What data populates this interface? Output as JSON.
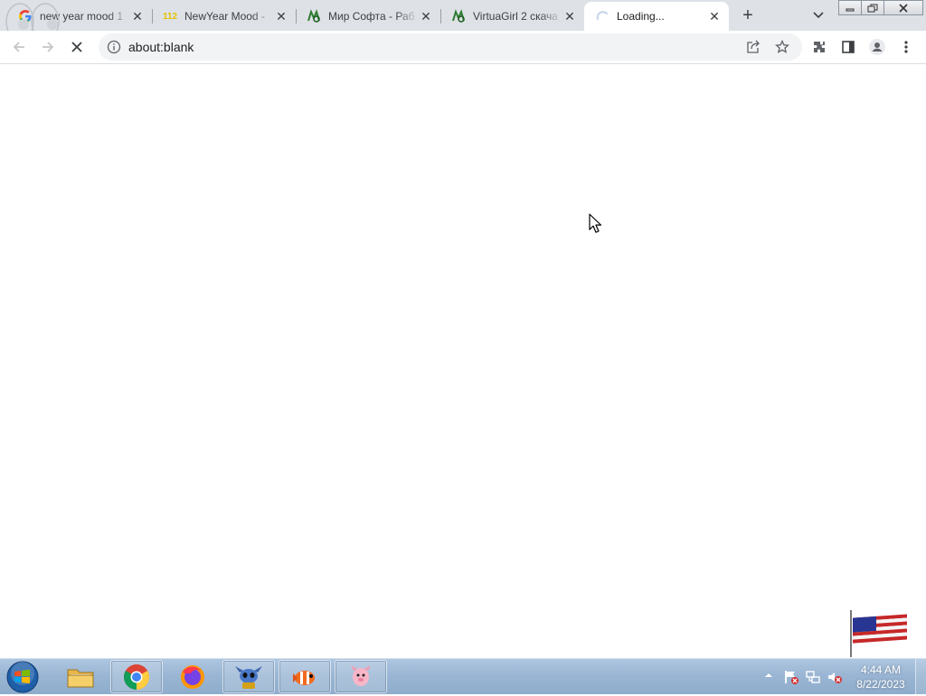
{
  "browser": {
    "tabs": [
      {
        "title": "new year mood 1",
        "favicon": "google-icon",
        "active": false
      },
      {
        "title": "NewYear Mood - ",
        "favicon": "site-112-icon",
        "favicon_text": "112",
        "active": false
      },
      {
        "title": "Мир Софта - Раб",
        "favicon": "mirsofta-icon",
        "active": false
      },
      {
        "title": "VirtuaGirl 2 скача",
        "favicon": "mirsofta-icon",
        "active": false
      },
      {
        "title": "Loading...",
        "favicon": "loading-spinner-icon",
        "active": true
      }
    ],
    "new_tab_icon": "plus-icon",
    "tab_search_icon": "chevron-down-icon",
    "address": {
      "url": "about:blank",
      "security_icon": "info-icon"
    },
    "toolbar_icons": [
      "back-icon",
      "forward-icon",
      "stop-icon",
      "share-icon",
      "star-icon",
      "extensions-icon",
      "side-panel-icon",
      "profile-icon",
      "menu-icon"
    ],
    "window_controls": [
      "minimize-icon",
      "restore-icon",
      "close-icon"
    ]
  },
  "taskbar": {
    "start_icon": "windows-start-icon",
    "items": [
      {
        "name": "explorer",
        "icon": "folder-icon",
        "pinned": false
      },
      {
        "name": "chrome",
        "icon": "chrome-icon",
        "pinned": true
      },
      {
        "name": "firefox",
        "icon": "firefox-icon",
        "pinned": false
      },
      {
        "name": "stitch",
        "icon": "stitch-icon",
        "pinned": true
      },
      {
        "name": "nemo",
        "icon": "clownfish-icon",
        "pinned": true
      },
      {
        "name": "piglet",
        "icon": "piglet-icon",
        "pinned": true
      }
    ],
    "tray": {
      "icons": [
        "show-hidden-icons-icon",
        "action-center-flag-icon",
        "network-icon",
        "volume-muted-icon"
      ],
      "time": "4:44 AM",
      "date": "8/22/2023"
    }
  },
  "colors": {
    "tabstrip": "#dee1e6",
    "omnibox": "#f1f3f4",
    "taskbar": "#9ab6d4"
  }
}
